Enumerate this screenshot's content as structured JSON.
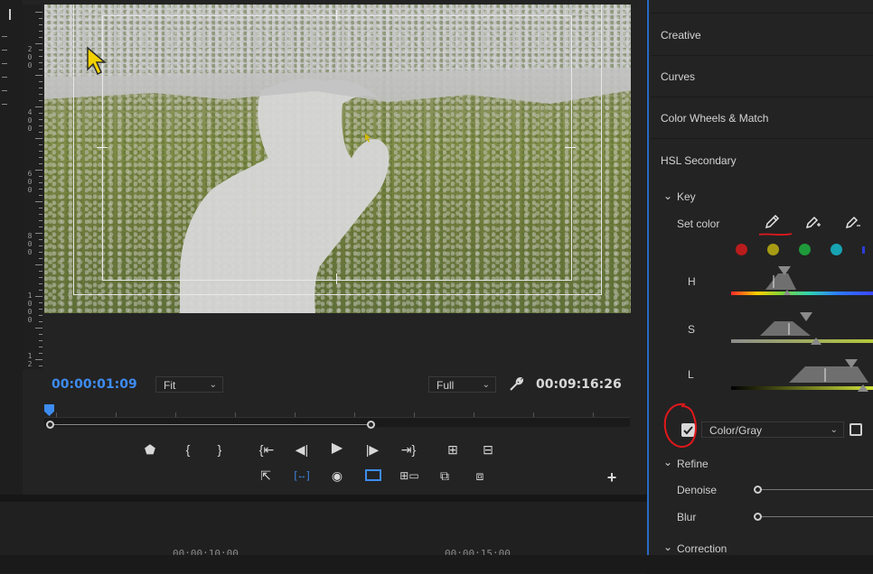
{
  "program_monitor": {
    "current_timecode": "00:00:01:09",
    "zoom_select": "Fit",
    "resolution_select": "Full",
    "duration_timecode": "00:09:16:26",
    "ruler_labels": [
      "2\n0\n0",
      "4\n0\n0",
      "6\n0\n0",
      "8\n0\n0",
      "1\n0\n0\n0",
      "1\n2"
    ],
    "playhead_progress": 0.0
  },
  "timeline": {
    "ruler_labels": [
      "00:00:10:00",
      "00:00:15:00"
    ]
  },
  "lumetri": {
    "sections": {
      "creative": "Creative",
      "curves": "Curves",
      "color_wheels": "Color Wheels & Match",
      "hsl_secondary": "HSL Secondary"
    },
    "key": {
      "label": "Key",
      "set_color_label": "Set color",
      "swatches": [
        "#b91c1c",
        "#a79b14",
        "#1f9a3a",
        "#17a3b2"
      ],
      "h_label": "H",
      "s_label": "S",
      "l_label": "L",
      "show_mask_checked": true,
      "mask_mode": "Color/Gray"
    },
    "refine": {
      "label": "Refine",
      "denoise_label": "Denoise",
      "blur_label": "Blur"
    },
    "correction": {
      "label": "Correction"
    }
  },
  "colors": {
    "timecode_blue": "#3d8cf0",
    "panel_accent": "#2a6ac6",
    "annotation_red": "#e0181c"
  }
}
